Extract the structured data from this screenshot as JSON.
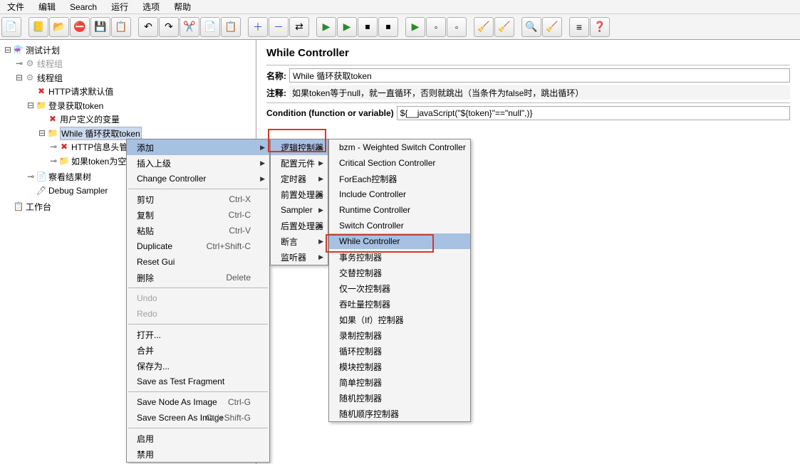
{
  "menubar": [
    "文件",
    "编辑",
    "Search",
    "运行",
    "选项",
    "帮助"
  ],
  "tree": {
    "root": "测试计划",
    "g1": "线程组",
    "g2": "线程组",
    "n1": "HTTP请求默认值",
    "n2": "登录获取token",
    "n3": "用户定义的变量",
    "n4": "While 循环获取token",
    "n5": "HTTP信息头管",
    "n6": "如果token为空",
    "n7": "察看结果树",
    "n8": "Debug Sampler",
    "wb": "工作台"
  },
  "panel": {
    "title": "While Controller",
    "name_label": "名称:",
    "name_value": "While 循环获取token",
    "comment_label": "注释:",
    "comment_value": "如果token等于null，就一直循环，否则就跳出（当条件为false时，跳出循环）",
    "cond_label": "Condition (function or variable)",
    "cond_value": "${__javaScript(\"${token}\"==\"null\",)}"
  },
  "ctx1": [
    {
      "t": "添加",
      "hi": true,
      "arrow": true
    },
    {
      "t": "插入上级",
      "arrow": true
    },
    {
      "t": "Change Controller",
      "arrow": true
    },
    {
      "sep": true
    },
    {
      "t": "剪切",
      "s": "Ctrl-X"
    },
    {
      "t": "复制",
      "s": "Ctrl-C"
    },
    {
      "t": "粘贴",
      "s": "Ctrl-V"
    },
    {
      "t": "Duplicate",
      "s": "Ctrl+Shift-C"
    },
    {
      "t": "Reset Gui"
    },
    {
      "t": "删除",
      "s": "Delete"
    },
    {
      "sep": true
    },
    {
      "t": "Undo",
      "dis": true
    },
    {
      "t": "Redo",
      "dis": true
    },
    {
      "sep": true
    },
    {
      "t": "打开..."
    },
    {
      "t": "合并"
    },
    {
      "t": "保存为..."
    },
    {
      "t": "Save as Test Fragment"
    },
    {
      "sep": true
    },
    {
      "t": "Save Node As Image",
      "s": "Ctrl-G"
    },
    {
      "t": "Save Screen As Image",
      "s": "Ctrl+Shift-G"
    },
    {
      "sep": true
    },
    {
      "t": "启用"
    },
    {
      "t": "禁用"
    }
  ],
  "ctx2": [
    {
      "t": "逻辑控制器",
      "hi": true,
      "arrow": true
    },
    {
      "t": "配置元件",
      "arrow": true
    },
    {
      "t": "定时器",
      "arrow": true
    },
    {
      "t": "前置处理器",
      "arrow": true
    },
    {
      "t": "Sampler",
      "arrow": true
    },
    {
      "t": "后置处理器",
      "arrow": true
    },
    {
      "t": "断言",
      "arrow": true
    },
    {
      "t": "监听器",
      "arrow": true
    }
  ],
  "ctx3": [
    {
      "t": "bzm - Weighted Switch Controller"
    },
    {
      "t": "Critical Section Controller"
    },
    {
      "t": "ForEach控制器"
    },
    {
      "t": "Include Controller"
    },
    {
      "t": "Runtime Controller"
    },
    {
      "t": "Switch Controller"
    },
    {
      "t": "While Controller",
      "hi": true
    },
    {
      "t": "事务控制器"
    },
    {
      "t": "交替控制器"
    },
    {
      "t": "仅一次控制器"
    },
    {
      "t": "吞吐量控制器"
    },
    {
      "t": "如果（If）控制器"
    },
    {
      "t": "录制控制器"
    },
    {
      "t": "循环控制器"
    },
    {
      "t": "模块控制器"
    },
    {
      "t": "简单控制器"
    },
    {
      "t": "随机控制器"
    },
    {
      "t": "随机顺序控制器"
    }
  ]
}
